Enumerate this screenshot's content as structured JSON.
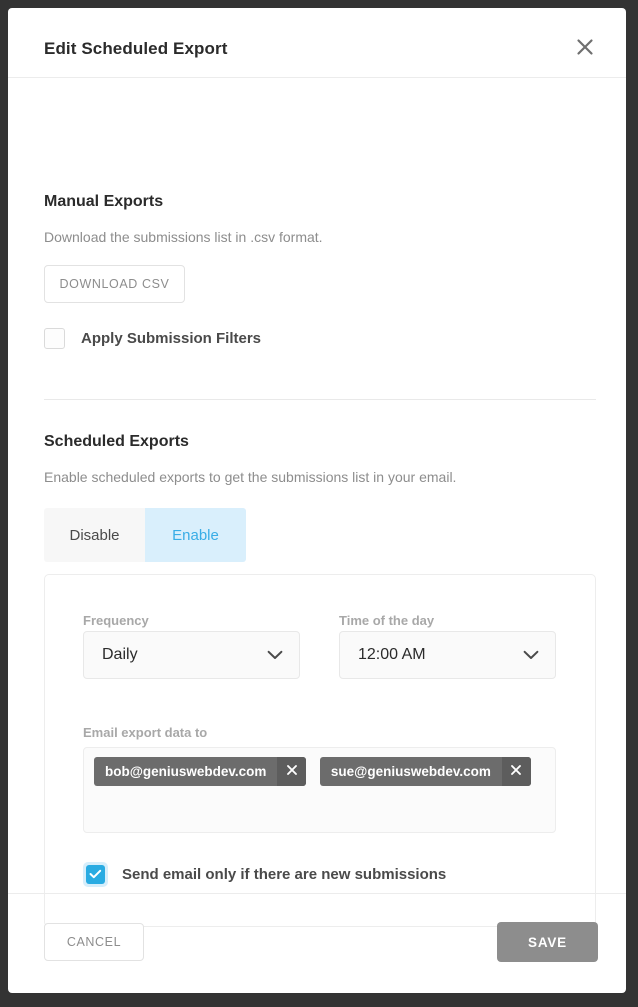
{
  "dialog": {
    "title": "Edit Scheduled Export",
    "close_icon": "close-icon"
  },
  "manual_exports": {
    "title": "Manual Exports",
    "description": "Download the submissions list in .csv format.",
    "download_button": "DOWNLOAD CSV",
    "apply_filters_label": "Apply Submission Filters",
    "apply_filters_checked": false
  },
  "scheduled_exports": {
    "title": "Scheduled Exports",
    "description": "Enable scheduled exports to get the submissions list in your email.",
    "toggle": {
      "disable_label": "Disable",
      "enable_label": "Enable",
      "selected": "Enable"
    },
    "frequency": {
      "label": "Frequency",
      "value": "Daily",
      "caret_icon": "chevron-down-icon"
    },
    "time_of_day": {
      "label": "Time of the day",
      "value": "12:00 AM",
      "caret_icon": "chevron-down-icon"
    },
    "emails": {
      "label": "Email export data to",
      "tags": [
        {
          "email": "bob@geniuswebdev.com",
          "remove_icon": "close-icon"
        },
        {
          "email": "sue@geniuswebdev.com",
          "remove_icon": "close-icon"
        }
      ]
    },
    "new_submissions_only": {
      "label": "Send email only if there are new submissions",
      "checked": true
    }
  },
  "footer": {
    "cancel_label": "CANCEL",
    "save_label": "SAVE"
  },
  "colors": {
    "accent_blue": "#29abe2",
    "toggle_active_bg": "#d9effc",
    "toggle_active_text": "#39ade6",
    "tag_bg": "#6c6c6c",
    "save_bg": "#8d8d8d",
    "overlay": "#333333"
  }
}
